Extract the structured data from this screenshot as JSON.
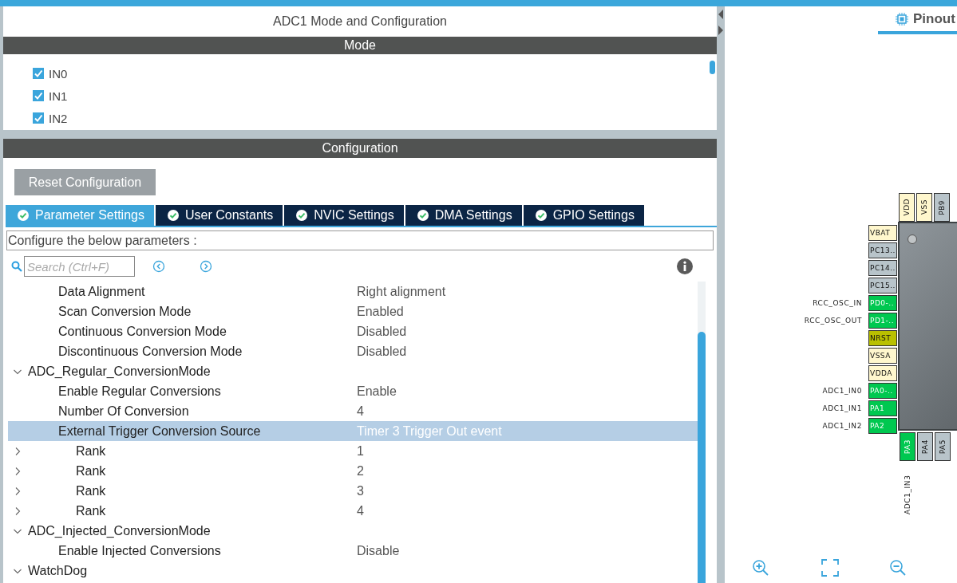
{
  "panel": {
    "title": "ADC1 Mode and Configuration"
  },
  "mode": {
    "header": "Mode",
    "channels": [
      {
        "label": "IN0",
        "checked": true
      },
      {
        "label": "IN1",
        "checked": true
      },
      {
        "label": "IN2",
        "checked": true
      }
    ]
  },
  "configuration": {
    "header": "Configuration",
    "reset_button": "Reset Configuration",
    "tabs": [
      {
        "label": "Parameter Settings",
        "selected": true
      },
      {
        "label": "User Constants",
        "selected": false
      },
      {
        "label": "NVIC Settings",
        "selected": false
      },
      {
        "label": "DMA Settings",
        "selected": false
      },
      {
        "label": "GPIO Settings",
        "selected": false
      }
    ],
    "description": "Configure the below parameters :",
    "search": {
      "placeholder": "Search (Ctrl+F)"
    },
    "tree": [
      {
        "kind": "param",
        "name": "Data Alignment",
        "value": "Right alignment",
        "selected": false
      },
      {
        "kind": "param",
        "name": "Scan Conversion Mode",
        "value": "Enabled",
        "selected": false
      },
      {
        "kind": "param",
        "name": "Continuous Conversion Mode",
        "value": "Disabled",
        "selected": false
      },
      {
        "kind": "param",
        "name": "Discontinuous Conversion Mode",
        "value": "Disabled",
        "selected": false
      },
      {
        "kind": "group",
        "name": "ADC_Regular_ConversionMode",
        "expanded": true,
        "selected": false,
        "children": [
          {
            "kind": "param",
            "name": "Enable Regular Conversions",
            "value": "Enable",
            "selected": false
          },
          {
            "kind": "param",
            "name": "Number Of Conversion",
            "value": "4",
            "selected": false
          },
          {
            "kind": "param",
            "name": "External Trigger Conversion Source",
            "value": "Timer 3 Trigger Out event",
            "selected": true
          },
          {
            "kind": "rank",
            "name": "Rank",
            "value": "1",
            "expanded": false,
            "selected": false
          },
          {
            "kind": "rank",
            "name": "Rank",
            "value": "2",
            "expanded": false,
            "selected": false
          },
          {
            "kind": "rank",
            "name": "Rank",
            "value": "3",
            "expanded": false,
            "selected": false
          },
          {
            "kind": "rank",
            "name": "Rank",
            "value": "4",
            "expanded": false,
            "selected": false
          }
        ]
      },
      {
        "kind": "group",
        "name": "ADC_Injected_ConversionMode",
        "expanded": true,
        "selected": false,
        "children": [
          {
            "kind": "param",
            "name": "Enable Injected Conversions",
            "value": "Disable",
            "selected": false
          }
        ]
      },
      {
        "kind": "group",
        "name": "WatchDog",
        "expanded": true,
        "selected": false
      }
    ]
  },
  "pinout": {
    "tab": "Pinout",
    "pins_top": [
      {
        "name": "VDD",
        "kind": "power"
      },
      {
        "name": "VSS",
        "kind": "power"
      },
      {
        "name": "PB9",
        "kind": "io"
      }
    ],
    "pins_left": [
      {
        "name": "VBAT",
        "kind": "power"
      },
      {
        "name": "PC13..",
        "kind": "io"
      },
      {
        "name": "PC14..",
        "kind": "io"
      },
      {
        "name": "PC15..",
        "kind": "io"
      },
      {
        "name": "PD0-..",
        "kind": "assigned",
        "signal": "RCC_OSC_IN"
      },
      {
        "name": "PD1-..",
        "kind": "assigned",
        "signal": "RCC_OSC_OUT"
      },
      {
        "name": "NRST",
        "kind": "reset"
      },
      {
        "name": "VSSA",
        "kind": "power"
      },
      {
        "name": "VDDA",
        "kind": "power"
      },
      {
        "name": "PA0-..",
        "kind": "assigned",
        "signal": "ADC1_IN0"
      },
      {
        "name": "PA1",
        "kind": "assigned",
        "signal": "ADC1_IN1"
      },
      {
        "name": "PA2",
        "kind": "assigned",
        "signal": "ADC1_IN2"
      }
    ],
    "pins_bottom": [
      {
        "name": "PA3",
        "kind": "assigned",
        "signal": "ADC1_IN3"
      },
      {
        "name": "PA4",
        "kind": "io"
      },
      {
        "name": "PA5",
        "kind": "io"
      }
    ]
  }
}
